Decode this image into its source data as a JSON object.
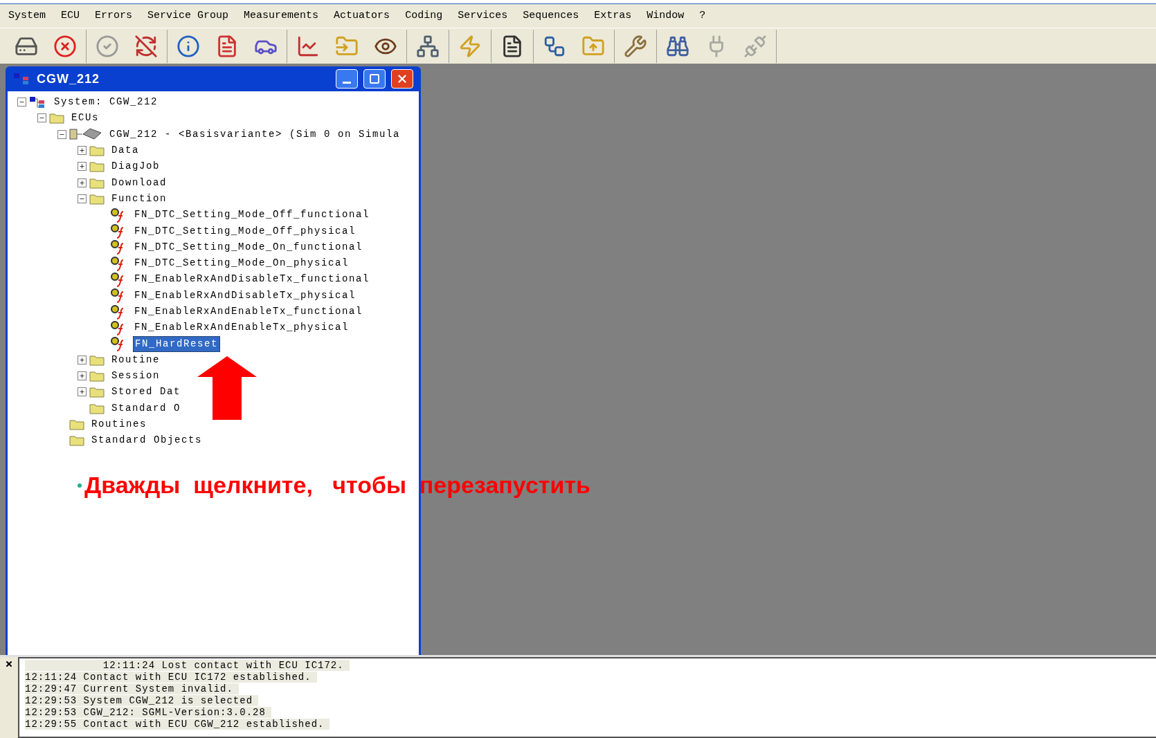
{
  "menu": [
    "System",
    "ECU",
    "Errors",
    "Service Group",
    "Measurements",
    "Actuators",
    "Coding",
    "Services",
    "Sequences",
    "Extras",
    "Window",
    "?"
  ],
  "toolbar": [
    [
      {
        "disabled": false
      },
      {
        "disabled": false
      }
    ],
    [
      {
        "disabled": false
      },
      {
        "disabled": false
      }
    ],
    [
      {
        "disabled": false
      },
      {
        "disabled": false
      },
      {
        "disabled": false
      }
    ],
    [
      {
        "disabled": false
      },
      {
        "disabled": false
      },
      {
        "disabled": false
      }
    ],
    [
      {
        "disabled": false
      }
    ],
    [
      {
        "disabled": false
      }
    ],
    [
      {
        "disabled": false
      }
    ],
    [
      {
        "disabled": false
      },
      {
        "disabled": false
      }
    ],
    [
      {
        "disabled": false
      }
    ],
    [
      {
        "disabled": false
      },
      {
        "disabled": true
      },
      {
        "disabled": true
      }
    ]
  ],
  "window": {
    "title": "CGW_212"
  },
  "tree": [
    {
      "kind": "system",
      "label": "System: CGW_212",
      "expanded": true,
      "selected": false,
      "children": [
        {
          "kind": "folder",
          "label": "ECUs",
          "expanded": true,
          "selected": false,
          "children": [
            {
              "kind": "ecu",
              "label": "CGW_212 - <Basisvariante> (Sim 0 on Simula",
              "expanded": true,
              "selected": false,
              "children": [
                {
                  "kind": "folder",
                  "label": "Data",
                  "expanded": false,
                  "selected": false
                },
                {
                  "kind": "folder",
                  "label": "DiagJob",
                  "expanded": false,
                  "selected": false
                },
                {
                  "kind": "folder",
                  "label": "Download",
                  "expanded": false,
                  "selected": false
                },
                {
                  "kind": "folder",
                  "label": "Function",
                  "expanded": true,
                  "selected": false,
                  "children": [
                    {
                      "kind": "function",
                      "label": "FN_DTC_Setting_Mode_Off_functional",
                      "selected": false
                    },
                    {
                      "kind": "function",
                      "label": "FN_DTC_Setting_Mode_Off_physical",
                      "selected": false
                    },
                    {
                      "kind": "function",
                      "label": "FN_DTC_Setting_Mode_On_functional",
                      "selected": false
                    },
                    {
                      "kind": "function",
                      "label": "FN_DTC_Setting_Mode_On_physical",
                      "selected": false
                    },
                    {
                      "kind": "function",
                      "label": "FN_EnableRxAndDisableTx_functional",
                      "selected": false
                    },
                    {
                      "kind": "function",
                      "label": "FN_EnableRxAndDisableTx_physical",
                      "selected": false
                    },
                    {
                      "kind": "function",
                      "label": "FN_EnableRxAndEnableTx_functional",
                      "selected": false
                    },
                    {
                      "kind": "function",
                      "label": "FN_EnableRxAndEnableTx_physical",
                      "selected": false
                    },
                    {
                      "kind": "function",
                      "label": "FN_HardReset",
                      "selected": true
                    }
                  ]
                },
                {
                  "kind": "folder",
                  "label": "Routine",
                  "expanded": false,
                  "selected": false
                },
                {
                  "kind": "folder",
                  "label": "Session",
                  "expanded": false,
                  "selected": false
                },
                {
                  "kind": "folder",
                  "label": "Stored Dat",
                  "expanded": false,
                  "selected": false
                },
                {
                  "kind": "folder",
                  "label": "Standard O",
                  "selected": false
                }
              ]
            },
            {
              "kind": "folder",
              "label": "Routines",
              "selected": false
            },
            {
              "kind": "folder",
              "label": "Standard Objects",
              "selected": false
            }
          ]
        }
      ]
    }
  ],
  "annotation": "Дважды  щелкните,   чтобы  перезапустить",
  "log": [
    "            12:11:24 Lost contact with ECU IC172.",
    "12:11:24 Contact with ECU IC172 established.",
    "12:29:47 Current System invalid.",
    "12:29:53 System CGW_212 is selected",
    "12:29:53 CGW_212: SGML-Version:3.0.28",
    "12:29:55 Contact with ECU CGW_212 established."
  ]
}
